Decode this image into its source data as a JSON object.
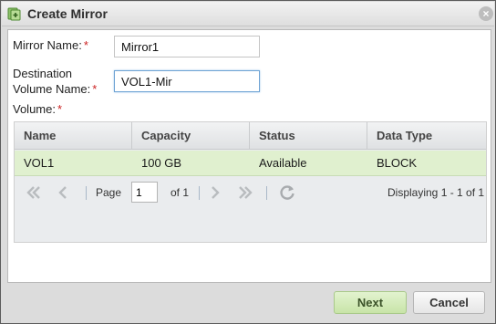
{
  "dialog": {
    "title": "Create Mirror",
    "icon": "mirror-plus-icon",
    "close_icon": "close-icon",
    "close_glyph": "×"
  },
  "form": {
    "mirror_name_label": "Mirror Name:",
    "mirror_name_value": "Mirror1",
    "destination_label_line1": "Destination",
    "destination_label_line2": "Volume Name:",
    "destination_value": "VOL1-Mir",
    "volume_label": "Volume:",
    "required_marker": "*"
  },
  "grid": {
    "columns": [
      "Name",
      "Capacity",
      "Status",
      "Data Type"
    ],
    "rows": [
      {
        "name": "VOL1",
        "capacity": "100 GB",
        "status": "Available",
        "data_type": "BLOCK"
      }
    ],
    "selected_row": 0
  },
  "pager": {
    "page_label": "Page",
    "page_value": "1",
    "of_label": "of 1",
    "displaying": "Displaying 1 - 1 of 1",
    "first_icon": "first-page-icon",
    "prev_icon": "previous-page-icon",
    "next_icon": "next-page-icon",
    "last_icon": "last-page-icon",
    "refresh_icon": "refresh-icon"
  },
  "buttons": {
    "next_label": "Next",
    "cancel_label": "Cancel"
  },
  "colors": {
    "selected_row": "#e0f0cf",
    "primary_button": "#c8e4a8",
    "required": "#cc2222"
  }
}
